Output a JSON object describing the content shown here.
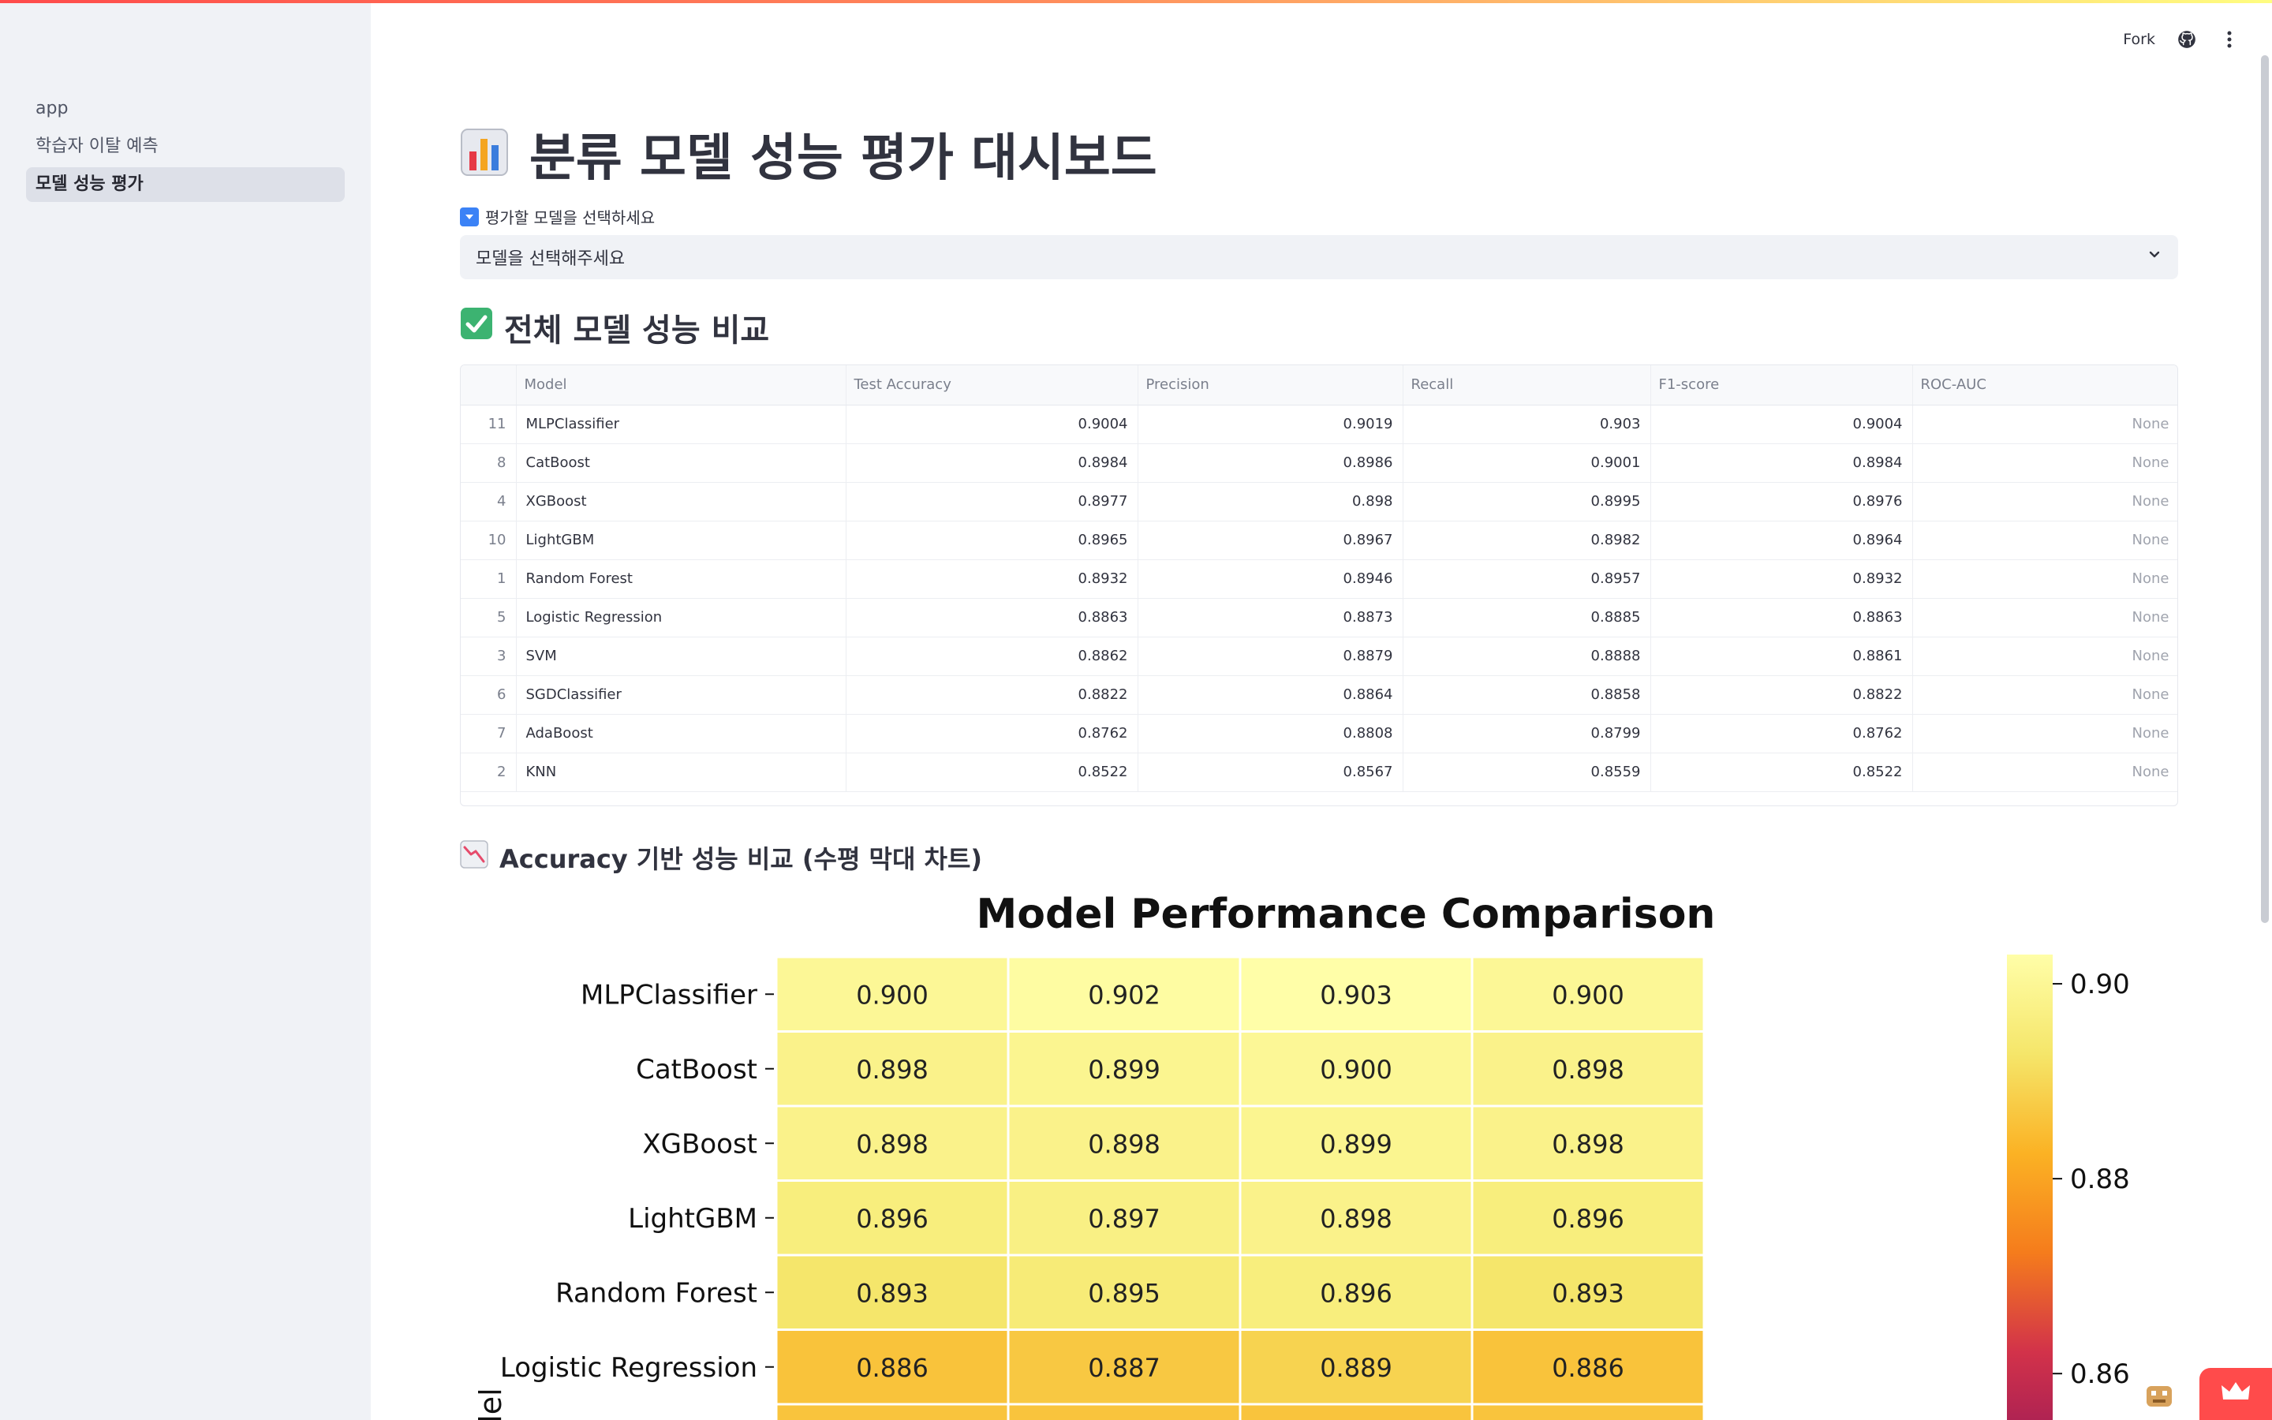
{
  "sidebar": {
    "items": [
      {
        "label": "app"
      },
      {
        "label": "학습자 이탈 예측"
      },
      {
        "label": "모델 성능 평가"
      }
    ]
  },
  "header": {
    "fork_label": "Fork"
  },
  "page": {
    "title": "분류 모델 성능 평가 대시보드",
    "select_label": "평가할 모델을 선택하세요",
    "select_value": "모델을 선택해주세요",
    "section_compare": "전체 모델 성능 비교",
    "section_chart": "Accuracy 기반 성능 비교 (수평 막대 차트)"
  },
  "table": {
    "columns": [
      "",
      "Model",
      "Test Accuracy",
      "Precision",
      "Recall",
      "F1-score",
      "ROC-AUC"
    ],
    "rows": [
      [
        "11",
        "MLPClassifier",
        "0.9004",
        "0.9019",
        "0.903",
        "0.9004",
        "None"
      ],
      [
        "8",
        "CatBoost",
        "0.8984",
        "0.8986",
        "0.9001",
        "0.8984",
        "None"
      ],
      [
        "4",
        "XGBoost",
        "0.8977",
        "0.898",
        "0.8995",
        "0.8976",
        "None"
      ],
      [
        "10",
        "LightGBM",
        "0.8965",
        "0.8967",
        "0.8982",
        "0.8964",
        "None"
      ],
      [
        "1",
        "Random Forest",
        "0.8932",
        "0.8946",
        "0.8957",
        "0.8932",
        "None"
      ],
      [
        "5",
        "Logistic Regression",
        "0.8863",
        "0.8873",
        "0.8885",
        "0.8863",
        "None"
      ],
      [
        "3",
        "SVM",
        "0.8862",
        "0.8879",
        "0.8888",
        "0.8861",
        "None"
      ],
      [
        "6",
        "SGDClassifier",
        "0.8822",
        "0.8864",
        "0.8858",
        "0.8822",
        "None"
      ],
      [
        "7",
        "AdaBoost",
        "0.8762",
        "0.8808",
        "0.8799",
        "0.8762",
        "None"
      ],
      [
        "2",
        "KNN",
        "0.8522",
        "0.8567",
        "0.8559",
        "0.8522",
        "None"
      ]
    ]
  },
  "chart_data": {
    "type": "heatmap",
    "title": "Model Performance Comparison",
    "ylabel": "odel",
    "categories": [
      "MLPClassifier",
      "CatBoost",
      "XGBoost",
      "LightGBM",
      "Random Forest",
      "Logistic Regression"
    ],
    "values": [
      [
        0.9,
        0.902,
        0.903,
        0.9
      ],
      [
        0.898,
        0.899,
        0.9,
        0.898
      ],
      [
        0.898,
        0.898,
        0.899,
        0.898
      ],
      [
        0.896,
        0.897,
        0.898,
        0.896
      ],
      [
        0.893,
        0.895,
        0.896,
        0.893
      ],
      [
        0.886,
        0.887,
        0.889,
        0.886
      ]
    ],
    "colorbar_ticks": [
      "0.90",
      "0.88",
      "0.86"
    ],
    "colorbar_tick_values": [
      0.9,
      0.88,
      0.86
    ],
    "colorbar_range": [
      0.852,
      0.903
    ],
    "colormap": [
      "#fffea8",
      "#f5e66a",
      "#fbb224",
      "#f57c1c",
      "#d2324a",
      "#a01c56"
    ]
  },
  "colors": {
    "accent": "#ff4b4b",
    "sidebar_bg": "#f0f2f6"
  }
}
